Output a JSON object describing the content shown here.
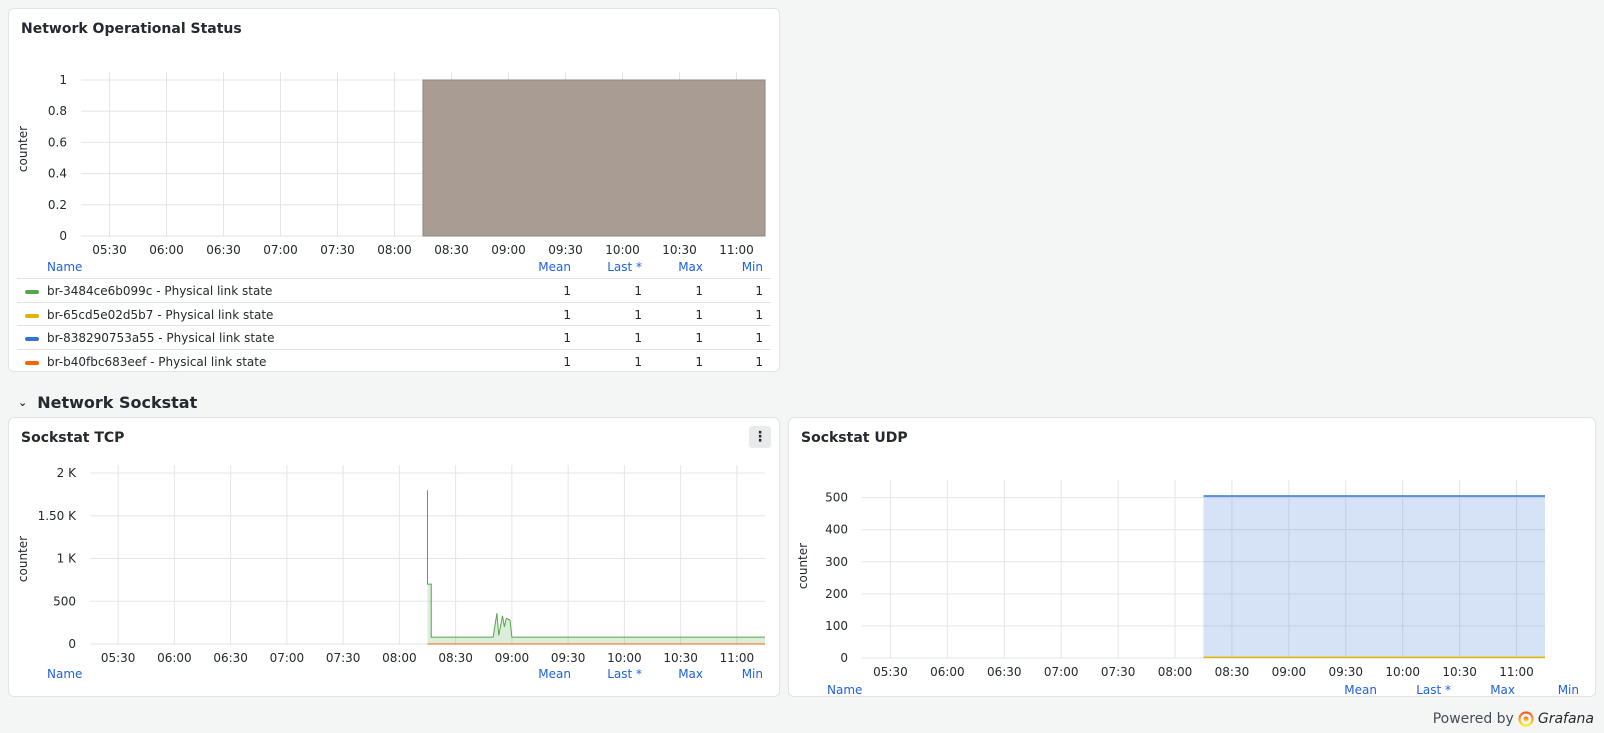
{
  "panels": {
    "net_status": {
      "title": "Network Operational Status",
      "ylabel": "counter",
      "legend": {
        "headers": {
          "name": "Name",
          "mean": "Mean",
          "last": "Last *",
          "max": "Max",
          "min": "Min"
        },
        "rows": [
          {
            "name": "br-3484ce6b099c - Physical link state",
            "color": "#56a64b",
            "mean": "1",
            "last": "1",
            "max": "1",
            "min": "1"
          },
          {
            "name": "br-65cd5e02d5b7 - Physical link state",
            "color": "#e0b400",
            "mean": "1",
            "last": "1",
            "max": "1",
            "min": "1"
          },
          {
            "name": "br-838290753a55 - Physical link state",
            "color": "#3274d9",
            "mean": "1",
            "last": "1",
            "max": "1",
            "min": "1"
          },
          {
            "name": "br-b40fbc683eef - Physical link state",
            "color": "#fa6400",
            "mean": "1",
            "last": "1",
            "max": "1",
            "min": "1"
          }
        ]
      }
    },
    "section": {
      "title": "Network Sockstat",
      "chevron": "chevron-down-icon"
    },
    "tcp": {
      "title": "Sockstat TCP",
      "menu": "⋮",
      "ylabel": "counter",
      "legend": {
        "headers": {
          "name": "Name",
          "mean": "Mean",
          "last": "Last *",
          "max": "Max",
          "min": "Min"
        }
      }
    },
    "udp": {
      "title": "Sockstat UDP",
      "ylabel": "counter",
      "legend": {
        "headers": {
          "name": "Name",
          "mean": "Mean",
          "last": "Last *",
          "max": "Max",
          "min": "Min"
        }
      }
    }
  },
  "footer": {
    "powered": "Powered by",
    "brand": "Grafana"
  },
  "chart_data": [
    {
      "type": "area",
      "title": "Network Operational Status",
      "ylabel": "counter",
      "x_ticks": [
        "05:30",
        "06:00",
        "06:30",
        "07:00",
        "07:30",
        "08:00",
        "08:30",
        "09:00",
        "09:30",
        "10:00",
        "10:30",
        "11:00"
      ],
      "y_ticks": [
        "0",
        "0.2",
        "0.4",
        "0.6",
        "0.8",
        "1"
      ],
      "ylim": [
        0,
        1
      ],
      "xlim": [
        "05:15",
        "11:15"
      ],
      "fill_color": "#a89c93",
      "series": [
        {
          "name": "br-3484ce6b099c - Physical link state",
          "start": "08:15",
          "end": "11:15",
          "value": 1
        }
      ]
    },
    {
      "type": "area",
      "title": "Sockstat TCP",
      "ylabel": "counter",
      "x_ticks": [
        "05:30",
        "06:00",
        "06:30",
        "07:00",
        "07:30",
        "08:00",
        "08:30",
        "09:00",
        "09:30",
        "10:00",
        "10:30",
        "11:00"
      ],
      "y_ticks": [
        "0",
        "500",
        "1 K",
        "1.50 K",
        "2 K"
      ],
      "ylim": [
        0,
        2000
      ],
      "xlim": [
        "05:15",
        "11:15"
      ],
      "series": [
        {
          "color": "#56a64b",
          "points": [
            [
              "08:15",
              1800
            ],
            [
              "08:15",
              700
            ],
            [
              "08:17",
              700
            ],
            [
              "08:17",
              80
            ],
            [
              "08:50",
              80
            ],
            [
              "08:52",
              360
            ],
            [
              "08:53",
              100
            ],
            [
              "08:55",
              330
            ],
            [
              "08:56",
              200
            ],
            [
              "08:57",
              300
            ],
            [
              "08:59",
              280
            ],
            [
              "09:00",
              80
            ],
            [
              "11:15",
              80
            ]
          ]
        },
        {
          "color": "#fa6400",
          "points": [
            [
              "08:15",
              0
            ],
            [
              "11:15",
              0
            ]
          ]
        }
      ]
    },
    {
      "type": "area",
      "title": "Sockstat UDP",
      "ylabel": "counter",
      "x_ticks": [
        "05:30",
        "06:00",
        "06:30",
        "07:00",
        "07:30",
        "08:00",
        "08:30",
        "09:00",
        "09:30",
        "10:00",
        "10:30",
        "11:00"
      ],
      "y_ticks": [
        "0",
        "100",
        "200",
        "300",
        "400",
        "500"
      ],
      "ylim": [
        0,
        530
      ],
      "xlim": [
        "05:15",
        "11:15"
      ],
      "series": [
        {
          "color": "#3274d9",
          "start": "08:15",
          "end": "11:15",
          "value": 505
        },
        {
          "color": "#e0b400",
          "start": "08:15",
          "end": "11:15",
          "value": 2
        }
      ]
    }
  ]
}
